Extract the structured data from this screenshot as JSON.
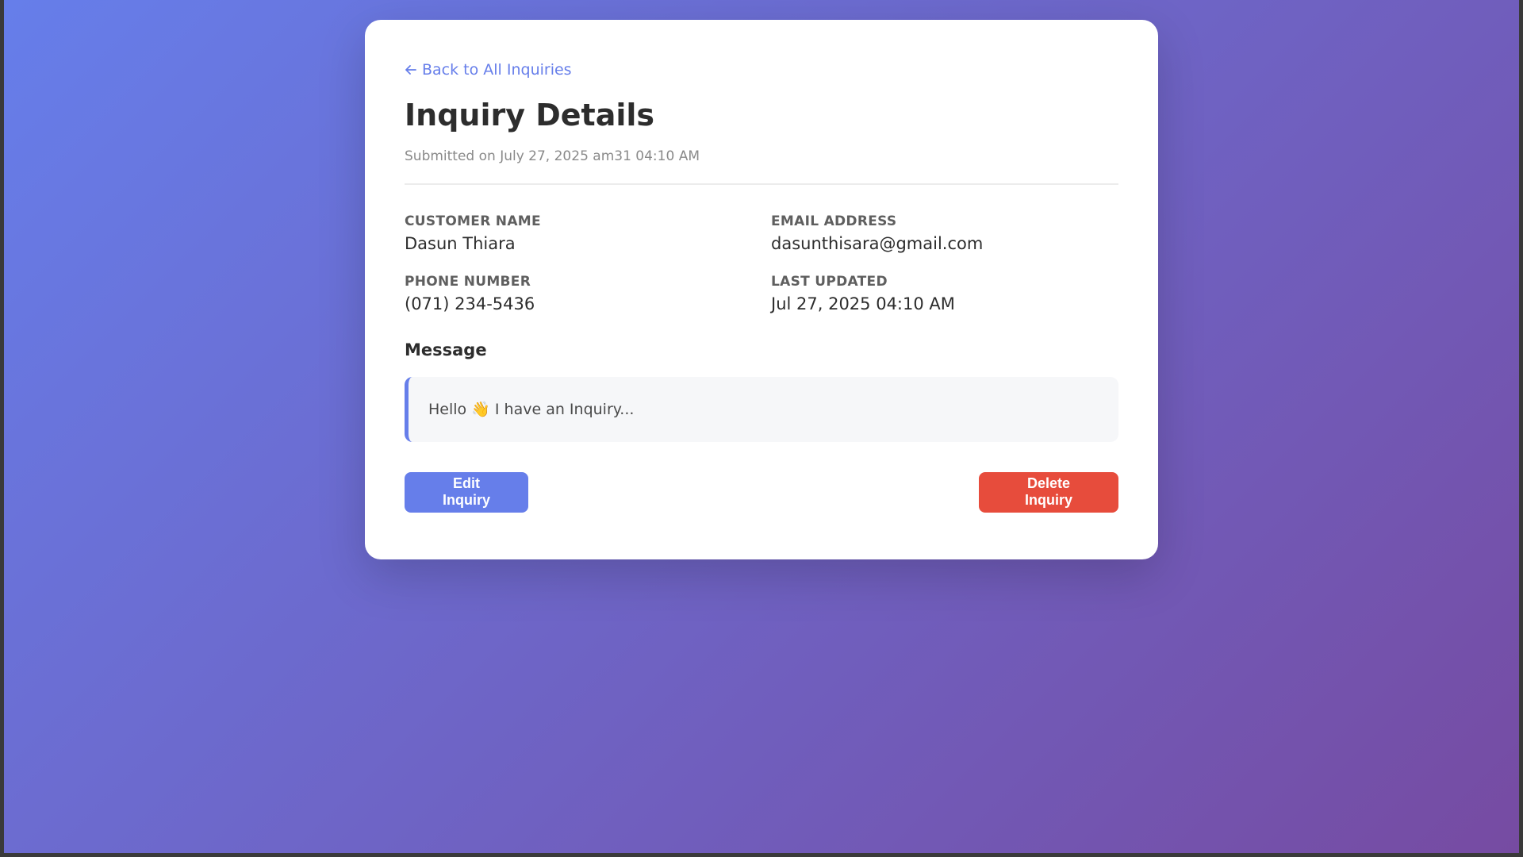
{
  "nav": {
    "back_label": "Back to All Inquiries"
  },
  "header": {
    "title": "Inquiry Details",
    "submitted": "Submitted on July 27, 2025 am31 04:10 AM"
  },
  "details": {
    "customer_name_label": "CUSTOMER NAME",
    "customer_name": "Dasun Thiara",
    "email_label": "EMAIL ADDRESS",
    "email": "dasunthisara@gmail.com",
    "phone_label": "PHONE NUMBER",
    "phone": "(071) 234-5436",
    "updated_label": "LAST UPDATED",
    "updated": "Jul 27, 2025 04:10 AM"
  },
  "message": {
    "heading": "Message",
    "text": "Hello 👋 I have an Inquiry..."
  },
  "actions": {
    "edit_label": "Edit Inquiry",
    "delete_label": "Delete Inquiry"
  },
  "colors": {
    "accent": "#667eea",
    "danger": "#e74c3c",
    "background_start": "#667eea",
    "background_end": "#764ba2"
  },
  "icons": {
    "back": "arrow-left-icon"
  }
}
